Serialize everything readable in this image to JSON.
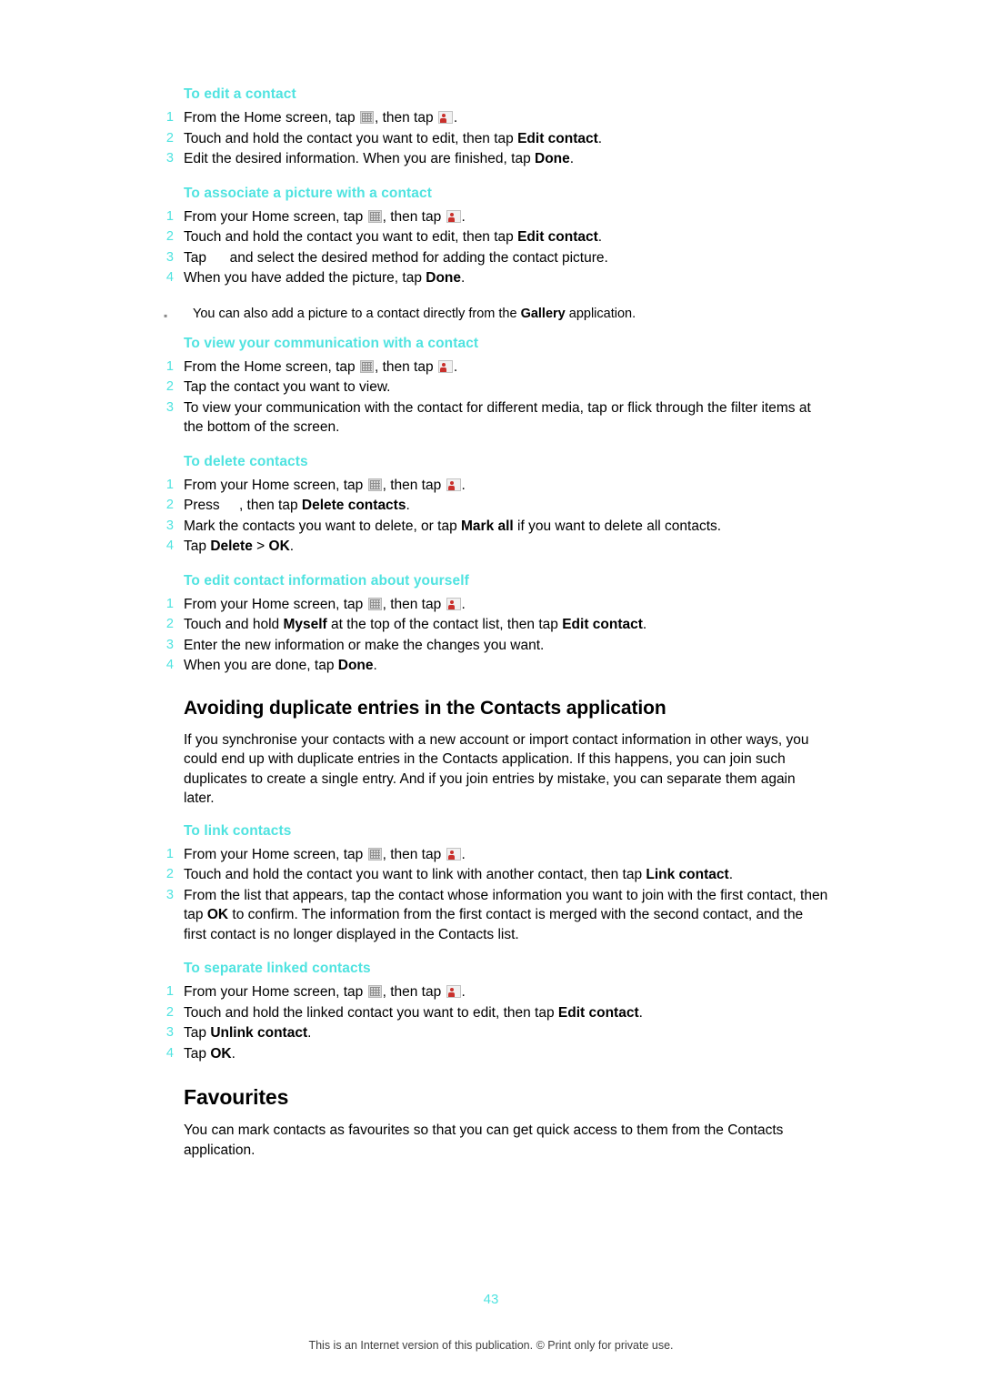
{
  "page": {
    "number": "43",
    "footer": "This is an Internet version of this publication. © Print only for private use."
  },
  "sections": [
    {
      "title": "To edit a contact",
      "steps": [
        {
          "num": "1",
          "html": "From the Home screen, tap [apps-icon], then tap [contact-icon]."
        },
        {
          "num": "2",
          "html": "Touch and hold the contact you want to edit, then tap <b>Edit contact</b>."
        },
        {
          "num": "3",
          "html": "Edit the desired information. When you are finished, tap <b>Done</b>."
        }
      ]
    },
    {
      "title": "To associate a picture with a contact",
      "steps": [
        {
          "num": "1",
          "html": "From your Home screen, tap [apps-icon], then tap [contact-icon]."
        },
        {
          "num": "2",
          "html": "Touch and hold the contact you want to edit, then tap <b>Edit contact</b>."
        },
        {
          "num": "3",
          "html": "Tap [blank-icon] and select the desired method for adding the contact picture."
        },
        {
          "num": "4",
          "html": "When you have added the picture, tap <b>Done</b>."
        }
      ],
      "note": "You can also add a picture to a contact directly from the <b>Gallery</b> application."
    },
    {
      "title": "To view your communication with a contact",
      "steps": [
        {
          "num": "1",
          "html": "From the Home screen, tap [apps-icon], then tap [contact-icon]."
        },
        {
          "num": "2",
          "html": "Tap the contact you want to view."
        },
        {
          "num": "3",
          "html": "To view your communication with the contact for different media, tap or flick through the filter items at the bottom of the screen."
        }
      ]
    },
    {
      "title": "To delete contacts",
      "steps": [
        {
          "num": "1",
          "html": "From your Home screen, tap [apps-icon], then tap [contact-icon]."
        },
        {
          "num": "2",
          "html": "Press [blank-icon], then tap <b>Delete contacts</b>."
        },
        {
          "num": "3",
          "html": "Mark the contacts you want to delete, or tap <b>Mark all</b> if you want to delete all contacts."
        },
        {
          "num": "4",
          "html": "Tap <b>Delete</b> > <b>OK</b>."
        }
      ]
    },
    {
      "title": "To edit contact information about yourself",
      "steps": [
        {
          "num": "1",
          "html": "From your Home screen, tap [apps-icon], then tap [contact-icon]."
        },
        {
          "num": "2",
          "html": "Touch and hold <b>Myself</b> at the top of the contact list, then tap <b>Edit contact</b>."
        },
        {
          "num": "3",
          "html": "Enter the new information or make the changes you want."
        },
        {
          "num": "4",
          "html": "When you are done, tap <b>Done</b>."
        }
      ]
    }
  ],
  "heading_duplicates": {
    "title": "Avoiding duplicate entries in the Contacts application",
    "paragraph": "If you synchronise your contacts with a new account or import contact information in other ways, you could end up with duplicate entries in the Contacts application. If this happens, you can join such duplicates to create a single entry. And if you join entries by mistake, you can separate them again later."
  },
  "sections2": [
    {
      "title": "To link contacts",
      "steps": [
        {
          "num": "1",
          "html": "From your Home screen, tap [apps-icon], then tap [contact-icon]."
        },
        {
          "num": "2",
          "html": "Touch and hold the contact you want to link with another contact, then tap <b>Link contact</b>."
        },
        {
          "num": "3",
          "html": "From the list that appears, tap the contact whose information you want to join with the first contact, then tap <b>OK</b> to confirm. The information from the first contact is merged with the second contact, and the first contact is no longer displayed in the Contacts list."
        }
      ]
    },
    {
      "title": "To separate linked contacts",
      "steps": [
        {
          "num": "1",
          "html": "From your Home screen, tap [apps-icon], then tap [contact-icon]."
        },
        {
          "num": "2",
          "html": "Touch and hold the linked contact you want to edit, then tap <b>Edit contact</b>."
        },
        {
          "num": "3",
          "html": "Tap <b>Unlink contact</b>."
        },
        {
          "num": "4",
          "html": "Tap <b>OK</b>."
        }
      ]
    }
  ],
  "heading_favourites": {
    "title": "Favourites",
    "paragraph": "You can mark contacts as favourites so that you can get quick access to them from the Contacts application."
  },
  "colors": {
    "accent": "#4fe3e0",
    "text": "#000000"
  },
  "icons": {
    "apps": "apps-grid-icon",
    "contact": "contacts-app-icon"
  }
}
